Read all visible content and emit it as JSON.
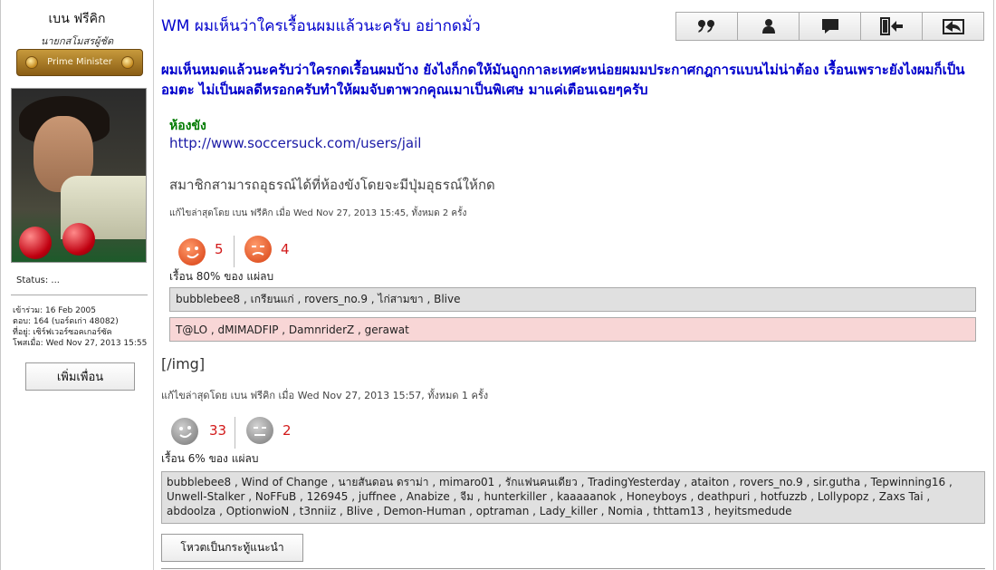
{
  "profile": {
    "username": "เบน ฟรีคิก",
    "user_title": "นายกสโมสรผู้ชัด",
    "rank_label": "Prime Minister",
    "status": "Status: ...",
    "joined": "เข้าร่วม: 16 Feb 2005",
    "posts": "ตอบ: 164 (บอร์ดเก่า 48082)",
    "location": "ที่อยู่: เซิร์ฟเวอร์ซอคเกอร์ซัค",
    "last_post": "โพสเมื่อ: Wed Nov 27, 2013 15:55",
    "add_friend_label": "เพิ่มเพื่อน"
  },
  "post": {
    "title": "WM ผมเห็นว่าใครเรื้อนผมแล้วนะครับ อย่ากดมั่ว",
    "lead": "ผมเห็นหมดแล้วนะครับว่าใครกดเรื้อนผมบ้าง ยังไงก็กดให้มันถูกกาละเทศะหน่อยผมมประกาศกฎการแบนไม่น่าต้อง เรื้อนเพราะยังไงผมก็เป็นอมตะ ไม่เป็นผลดีหรอกครับทำให้ผมจับตาพวกคุณเมาเป็นพิเศษ มาแค่เตือนเฉยๆครับ",
    "toolbar": [
      {
        "name": "quote-button",
        "icon": "quote-icon"
      },
      {
        "name": "profile-button",
        "icon": "user-icon"
      },
      {
        "name": "message-button",
        "icon": "chat-icon"
      },
      {
        "name": "exit-button",
        "icon": "door-exit-icon"
      },
      {
        "name": "reply-button",
        "icon": "reply-icon"
      }
    ],
    "quote": {
      "jail_label": "ห้องขัง",
      "jail_url": "http://www.soccersuck.com/users/jail",
      "jail_note": "สมาชิกสามารถอุธรณ์ได้ที่ห้องขังโดยจะมีปุ่มอุธรณ์ให้กด",
      "edit_note": "แก้ไขล่าสุดโดย เบน ฟรีคิก เมื่อ Wed Nov 27, 2013 15:45, ทั้งหมด 2 ครั้ง",
      "likes": "5",
      "dislikes": "4",
      "summary": "เรื้อน 80% ของ แผ่ลบ",
      "like_voters": "bubblebee8 , เกรียนแก่ , rovers_no.9 , ไก่สามขา , Blive",
      "dislike_voters": "T@LO , dMIMADFIP , DamnriderZ , gerawat"
    },
    "img_tag": "[/img]",
    "edit_note": "แก้ไขล่าสุดโดย เบน ฟรีคิก เมื่อ Wed Nov 27, 2013 15:57, ทั้งหมด 1 ครั้ง",
    "reactions": {
      "likes": "33",
      "dislikes": "2",
      "summary": "เรื้อน 6% ของ แผ่ลบ",
      "like_voters": "bubblebee8 , Wind of Change , นายสันดอน ดราม่า , mimaro01 , รักแฟนคนเดียว , TradingYesterday , ataiton , rovers_no.9 , sir.gutha , Tepwinning16 , Unwell-Stalker , NoFFuB , 126945 , juffnee , Anabize , จีม , hunterkiller , kaaaaanok , Honeyboys , deathpuri , hotfuzzb , Lollypopz , Zaxs Tai , abdoolza , OptionwioN , t3nniiz , Blive , Demon-Human , optraman , Lady_killer , Nomia , thttam13 , heyitsmedude"
    },
    "recommend_label": "โหวตเป็นกระทู้แนะนำ"
  },
  "colors": {
    "title_blue": "#0000cc",
    "jail_green": "#007a00",
    "count_red": "#d21a1a",
    "like_box": "#e0e0e0",
    "dislike_box": "#f8d6d6"
  }
}
